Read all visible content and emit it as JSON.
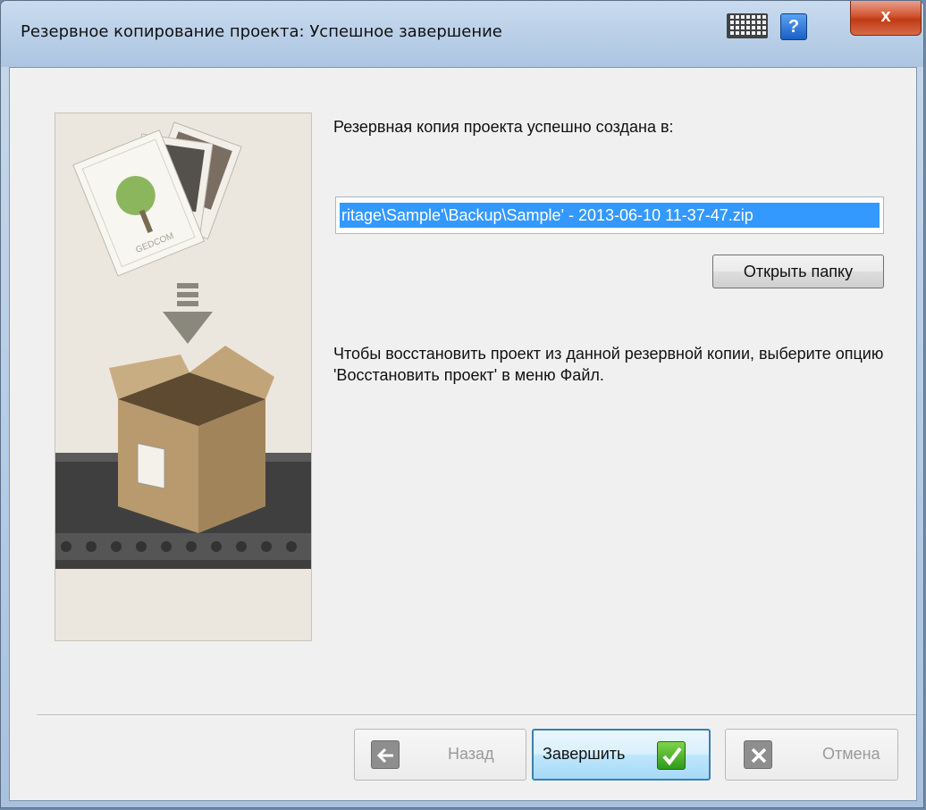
{
  "window": {
    "title": "Резервное копирование проекта: Успешное завершение",
    "close_symbol": "x",
    "help_symbol": "?",
    "icons": [
      "keyboard-icon",
      "help-icon",
      "close-icon"
    ]
  },
  "content": {
    "heading": "Резервная копия проекта успешно создана в:",
    "path_value": "ritage\\Sample'\\Backup\\Sample' - 2013-06-10 11-37-47.zip",
    "open_folder_label": "Открыть папку",
    "restore_hint": "Чтобы восстановить проект из данной резервной копии, выберите опцию 'Восстановить проект' в меню Файл.",
    "illustration_text": "GEDCOM"
  },
  "footer": {
    "back_label": "Назад",
    "finish_label": "Завершить",
    "cancel_label": "Отмена",
    "back_enabled": false,
    "cancel_enabled": false
  },
  "colors": {
    "selection": "#3399ff",
    "finish_check": "#3aa523",
    "close_button": "#c8472a"
  }
}
